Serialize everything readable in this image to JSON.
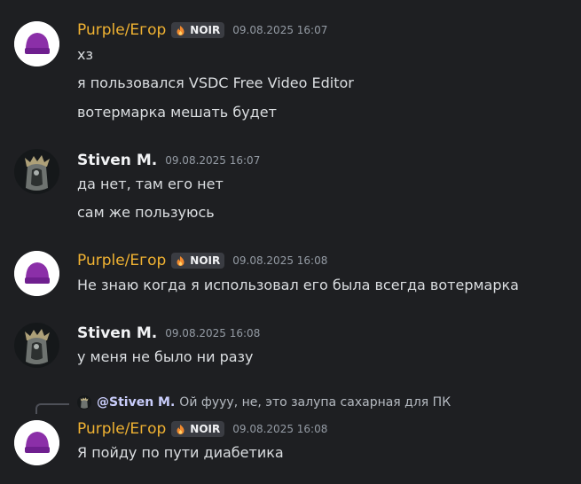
{
  "messages": [
    {
      "author": "Purple/Егор",
      "badge": "NOIR",
      "timestamp": "09.08.2025 16:07",
      "lines": [
        "хз",
        "я пользовался VSDC Free Video Editor",
        "вотермарка мешать будет"
      ]
    },
    {
      "author": "Stiven M.",
      "timestamp": "09.08.2025 16:07",
      "lines": [
        "да нет, там его нет",
        "сам же пользуюсь"
      ]
    },
    {
      "author": "Purple/Егор",
      "badge": "NOIR",
      "timestamp": "09.08.2025 16:08",
      "lines": [
        "Не знаю когда я использовал его была всегда вотермарка"
      ]
    },
    {
      "author": "Stiven M.",
      "timestamp": "09.08.2025 16:08",
      "lines": [
        "у меня не было ни разу"
      ]
    },
    {
      "author": "Purple/Егор",
      "badge": "NOIR",
      "timestamp": "09.08.2025 16:08",
      "reply": {
        "mention": "@Stiven M.",
        "preview": "Ой фууу, не, это залупа сахарная для ПК"
      },
      "lines": [
        "Я пойду по пути диабетика"
      ]
    }
  ],
  "colors": {
    "background": "#1e1f22",
    "purple_username": "#f0b232",
    "timestamp": "#949ba4",
    "text": "#dbdee1",
    "badge_bg": "#3a3c42"
  }
}
